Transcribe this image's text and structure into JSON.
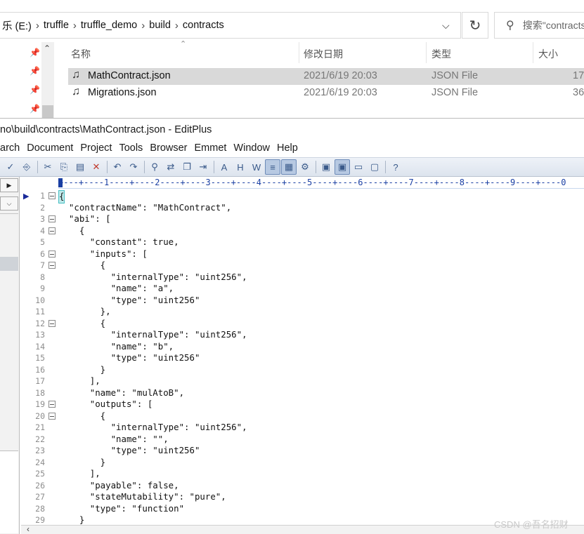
{
  "explorer": {
    "breadcrumb": [
      "乐 (E:)",
      "truffle",
      "truffle_demo",
      "build",
      "contracts"
    ],
    "search_placeholder": "搜索\"contracts\"",
    "columns": {
      "name": "名称",
      "date": "修改日期",
      "type": "类型",
      "size": "大小"
    },
    "files": [
      {
        "name": "MathContract.json",
        "date": "2021/6/19 20:03",
        "type": "JSON File",
        "size": "17",
        "selected": true
      },
      {
        "name": "Migrations.json",
        "date": "2021/6/19 20:03",
        "type": "JSON File",
        "size": "36",
        "selected": false
      }
    ]
  },
  "editplus": {
    "title": "no\\build\\contracts\\MathContract.json - EditPlus",
    "menu": [
      "arch",
      "Document",
      "Project",
      "Tools",
      "Browser",
      "Emmet",
      "Window",
      "Help"
    ],
    "ruler": "+---+----1----+----2----+----3----+----4----+----5----+----6----+----7----+----8----+----9----+----0",
    "lines": [
      {
        "n": "1",
        "fold": true,
        "text": "{"
      },
      {
        "n": "2",
        "fold": false,
        "text": "  \"contractName\": \"MathContract\","
      },
      {
        "n": "3",
        "fold": true,
        "text": "  \"abi\": ["
      },
      {
        "n": "4",
        "fold": true,
        "text": "    {"
      },
      {
        "n": "5",
        "fold": false,
        "text": "      \"constant\": true,"
      },
      {
        "n": "6",
        "fold": true,
        "text": "      \"inputs\": ["
      },
      {
        "n": "7",
        "fold": true,
        "text": "        {"
      },
      {
        "n": "8",
        "fold": false,
        "text": "          \"internalType\": \"uint256\","
      },
      {
        "n": "9",
        "fold": false,
        "text": "          \"name\": \"a\","
      },
      {
        "n": "10",
        "fold": false,
        "text": "          \"type\": \"uint256\""
      },
      {
        "n": "11",
        "fold": false,
        "text": "        },"
      },
      {
        "n": "12",
        "fold": true,
        "text": "        {"
      },
      {
        "n": "13",
        "fold": false,
        "text": "          \"internalType\": \"uint256\","
      },
      {
        "n": "14",
        "fold": false,
        "text": "          \"name\": \"b\","
      },
      {
        "n": "15",
        "fold": false,
        "text": "          \"type\": \"uint256\""
      },
      {
        "n": "16",
        "fold": false,
        "text": "        }"
      },
      {
        "n": "17",
        "fold": false,
        "text": "      ],"
      },
      {
        "n": "18",
        "fold": false,
        "text": "      \"name\": \"mulAtoB\","
      },
      {
        "n": "19",
        "fold": true,
        "text": "      \"outputs\": ["
      },
      {
        "n": "20",
        "fold": true,
        "text": "        {"
      },
      {
        "n": "21",
        "fold": false,
        "text": "          \"internalType\": \"uint256\","
      },
      {
        "n": "22",
        "fold": false,
        "text": "          \"name\": \"\","
      },
      {
        "n": "23",
        "fold": false,
        "text": "          \"type\": \"uint256\""
      },
      {
        "n": "24",
        "fold": false,
        "text": "        }"
      },
      {
        "n": "25",
        "fold": false,
        "text": "      ],"
      },
      {
        "n": "26",
        "fold": false,
        "text": "      \"payable\": false,"
      },
      {
        "n": "27",
        "fold": false,
        "text": "      \"stateMutability\": \"pure\","
      },
      {
        "n": "28",
        "fold": false,
        "text": "      \"type\": \"function\""
      },
      {
        "n": "29",
        "fold": false,
        "text": "    }"
      }
    ]
  },
  "watermark": "CSDN @吾名招财"
}
